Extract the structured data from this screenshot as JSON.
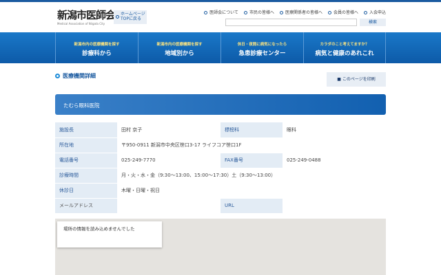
{
  "header": {
    "logo_text": "新潟市医師会",
    "logo_sub": "Medical Association of Niigata City",
    "home_button": [
      "ホームページ",
      "TOPに戻る"
    ],
    "links": [
      "医師会について",
      "市民の皆様へ",
      "医療関係者の皆様へ",
      "会員の皆様へ",
      "入会申込"
    ],
    "search_placeholder": "",
    "search_button": "検索"
  },
  "nav": [
    {
      "sub": "新潟市内の医療機関を探す",
      "main": "診療科から"
    },
    {
      "sub": "新潟市内の医療機関を探す",
      "main": "地域別から"
    },
    {
      "sub": "休日・夜間に病気になったら",
      "main": "急患診療センター"
    },
    {
      "sub": "カラダのこと考えてますか？",
      "main": "病気と健康のあれこれ"
    }
  ],
  "section_title": "医療機関詳細",
  "print_button": "このページを印刷",
  "hospital_name": "たむら眼科医院",
  "details": {
    "director_label": "施設長",
    "director": "田村 京子",
    "dept_label": "標榜科",
    "dept": "眼科",
    "address_label": "所在地",
    "address": "〒950-0911 新潟市中央区笹口3-17 ライフコア笹口1F",
    "tel_label": "電話番号",
    "tel": "025-249-7770",
    "fax_label": "FAX番号",
    "fax": "025-249-0488",
    "hours_label": "診療時間",
    "hours": "月・火・水・金（9:30〜13:00、15:00〜17:30）土（9:30〜13:00）",
    "closed_label": "休診日",
    "closed": "木曜・日曜・祝日",
    "email_label": "メールアドレス",
    "email": "",
    "url_label": "URL",
    "url": ""
  },
  "map_error": "場所の情報を読み込めませんでした"
}
